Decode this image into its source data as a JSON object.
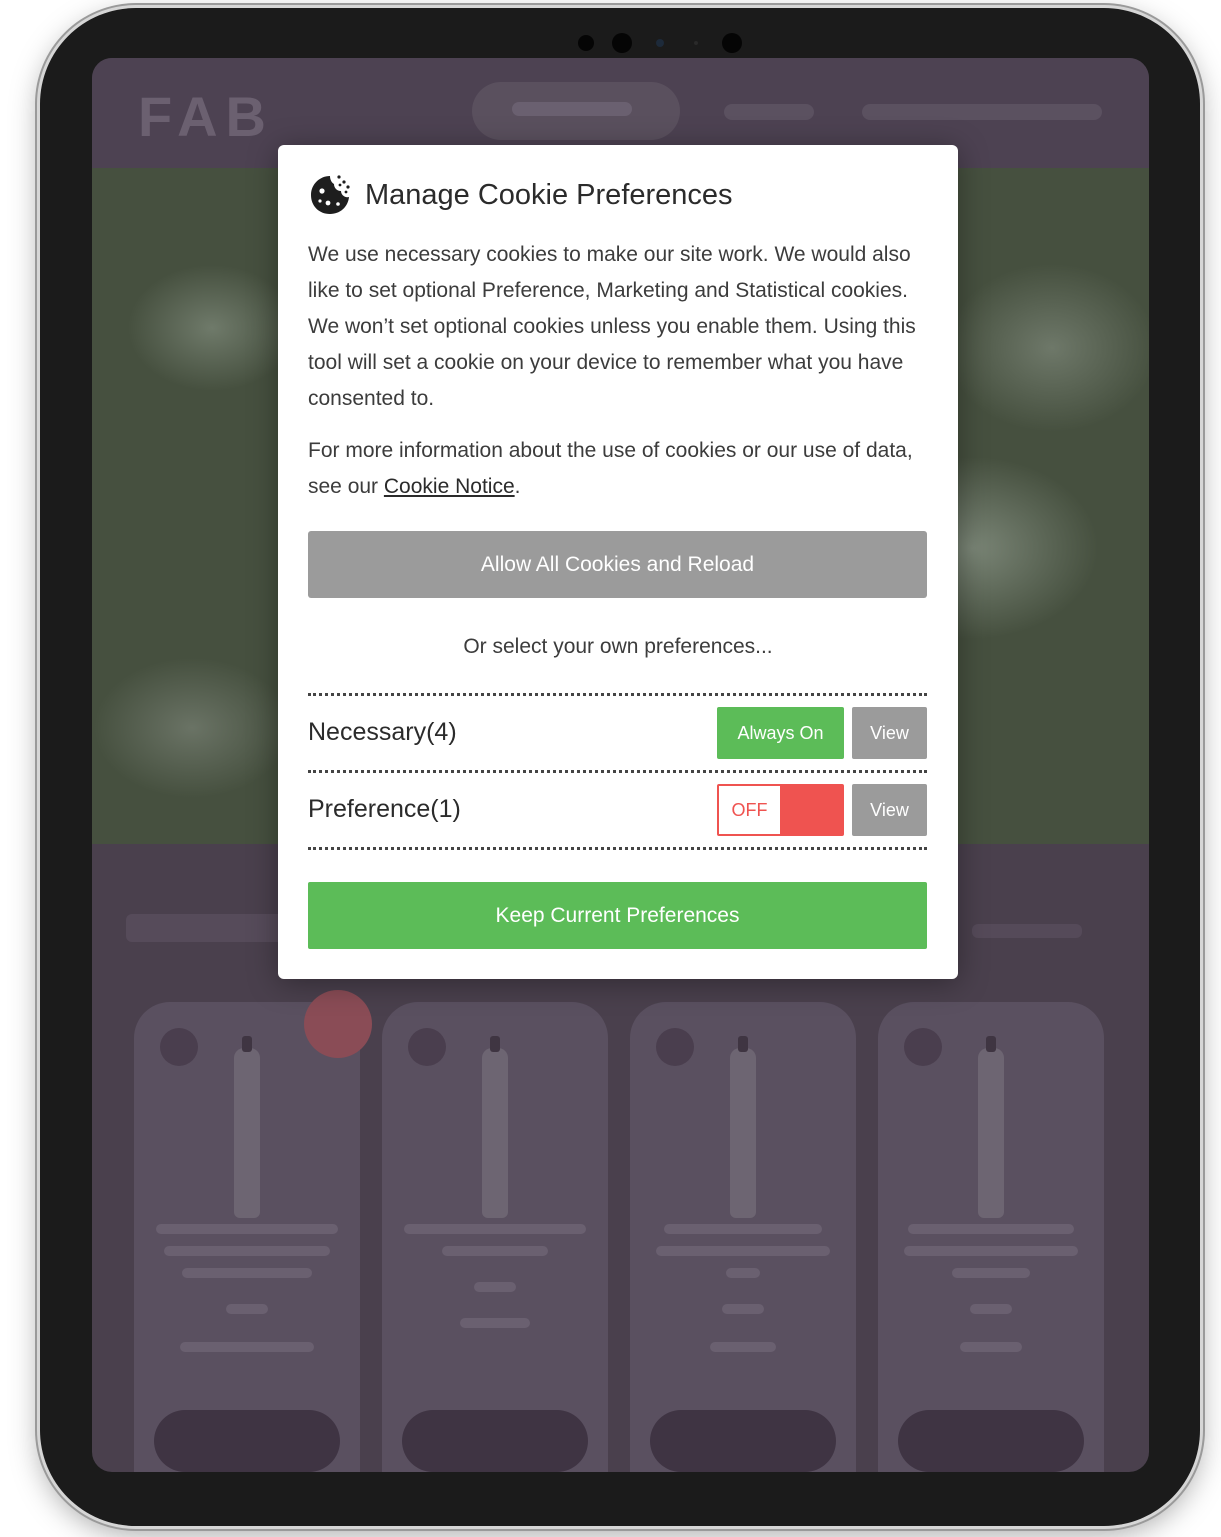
{
  "background_site": {
    "logo": "FAB"
  },
  "modal": {
    "title": "Manage Cookie Preferences",
    "intro": "We use necessary cookies to make our site work. We would also like to set optional Preference, Marketing and Statistical cookies. We won’t set optional cookies unless you enable them. Using this tool will set a cookie on your device to remember what you have consented to.",
    "more_info_prefix": "For more information about the use of cookies or our use of data, see our ",
    "cookie_notice_link": "Cookie Notice",
    "more_info_suffix": ".",
    "allow_all_label": "Allow All Cookies and Reload",
    "or_select_text": "Or select your own preferences...",
    "categories": [
      {
        "label": "Necessary(4)",
        "status_label": "Always On",
        "view_label": "View"
      },
      {
        "label": "Preference(1)",
        "toggle_label": "OFF",
        "toggle_state": "off",
        "view_label": "View"
      }
    ],
    "keep_label": "Keep Current Preferences"
  },
  "colors": {
    "accent_green": "#5cbc58",
    "off_red": "#ef5350",
    "button_gray": "#9b9b9b",
    "overlay": "#4a404d"
  },
  "icons": [
    "cookie-icon"
  ]
}
